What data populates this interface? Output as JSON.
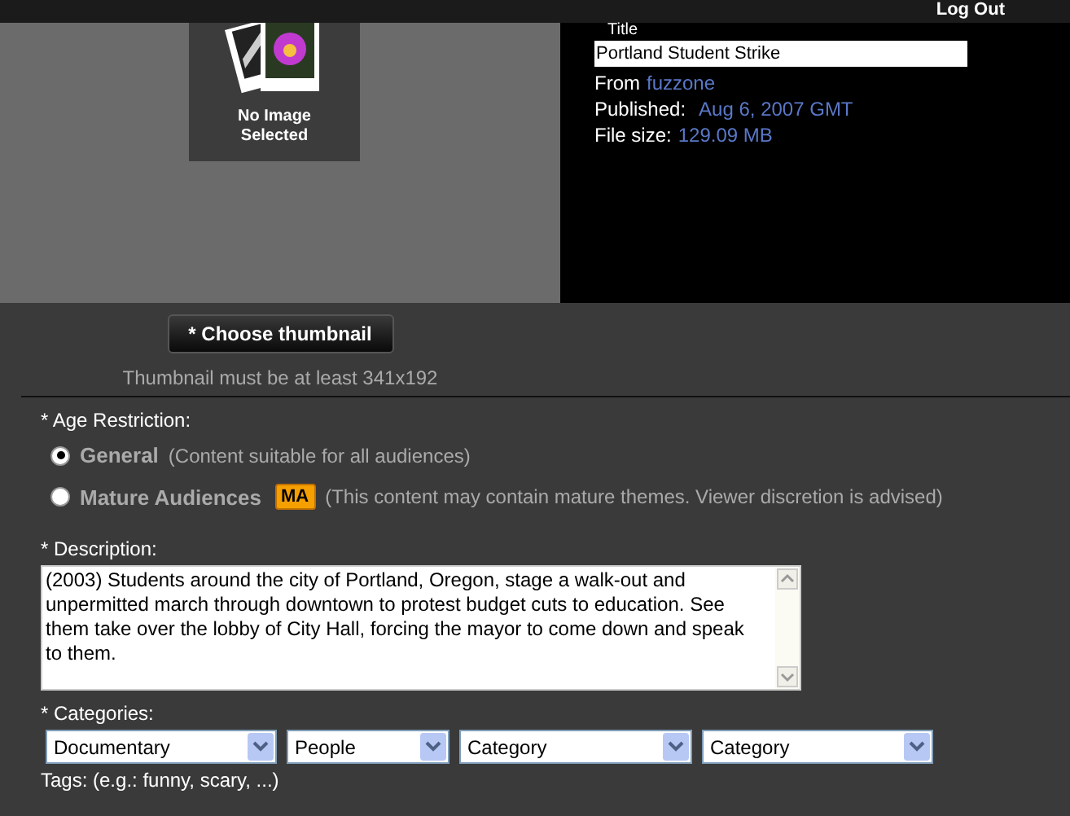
{
  "header": {
    "logout_link": "Log Out"
  },
  "thumbnail": {
    "placeholder_caption": "No Image Selected",
    "choose_button": "* Choose thumbnail",
    "hint": "Thumbnail must be at least 341x192"
  },
  "details": {
    "title_label": "Title",
    "title_value": "Portland Student Strike",
    "from_label": "From",
    "from_value": "fuzzone",
    "published_label": "Published:",
    "published_value": "Aug 6, 2007 GMT",
    "size_label": "File size:",
    "size_value": "129.09 MB"
  },
  "age_restriction": {
    "label": "* Age Restriction:",
    "options": [
      {
        "name": "General",
        "note": "(Content suitable for all audiences)",
        "selected": true
      },
      {
        "name": "Mature Audiences",
        "badge": "MA",
        "note": "(This content may contain mature themes. Viewer discretion is advised)",
        "selected": false
      }
    ]
  },
  "description": {
    "label": "* Description:",
    "value": "(2003) Students around the city of Portland, Oregon, stage a walk-out and unpermitted march through downtown to protest budget cuts to education. See them take over the lobby of City Hall, forcing the mayor to come down and speak to them."
  },
  "categories": {
    "label": "* Categories:",
    "selects": [
      "Documentary",
      "People",
      "Category",
      "Category"
    ]
  },
  "tags": {
    "label": "Tags: (e.g.: funny, scary, ...)"
  }
}
